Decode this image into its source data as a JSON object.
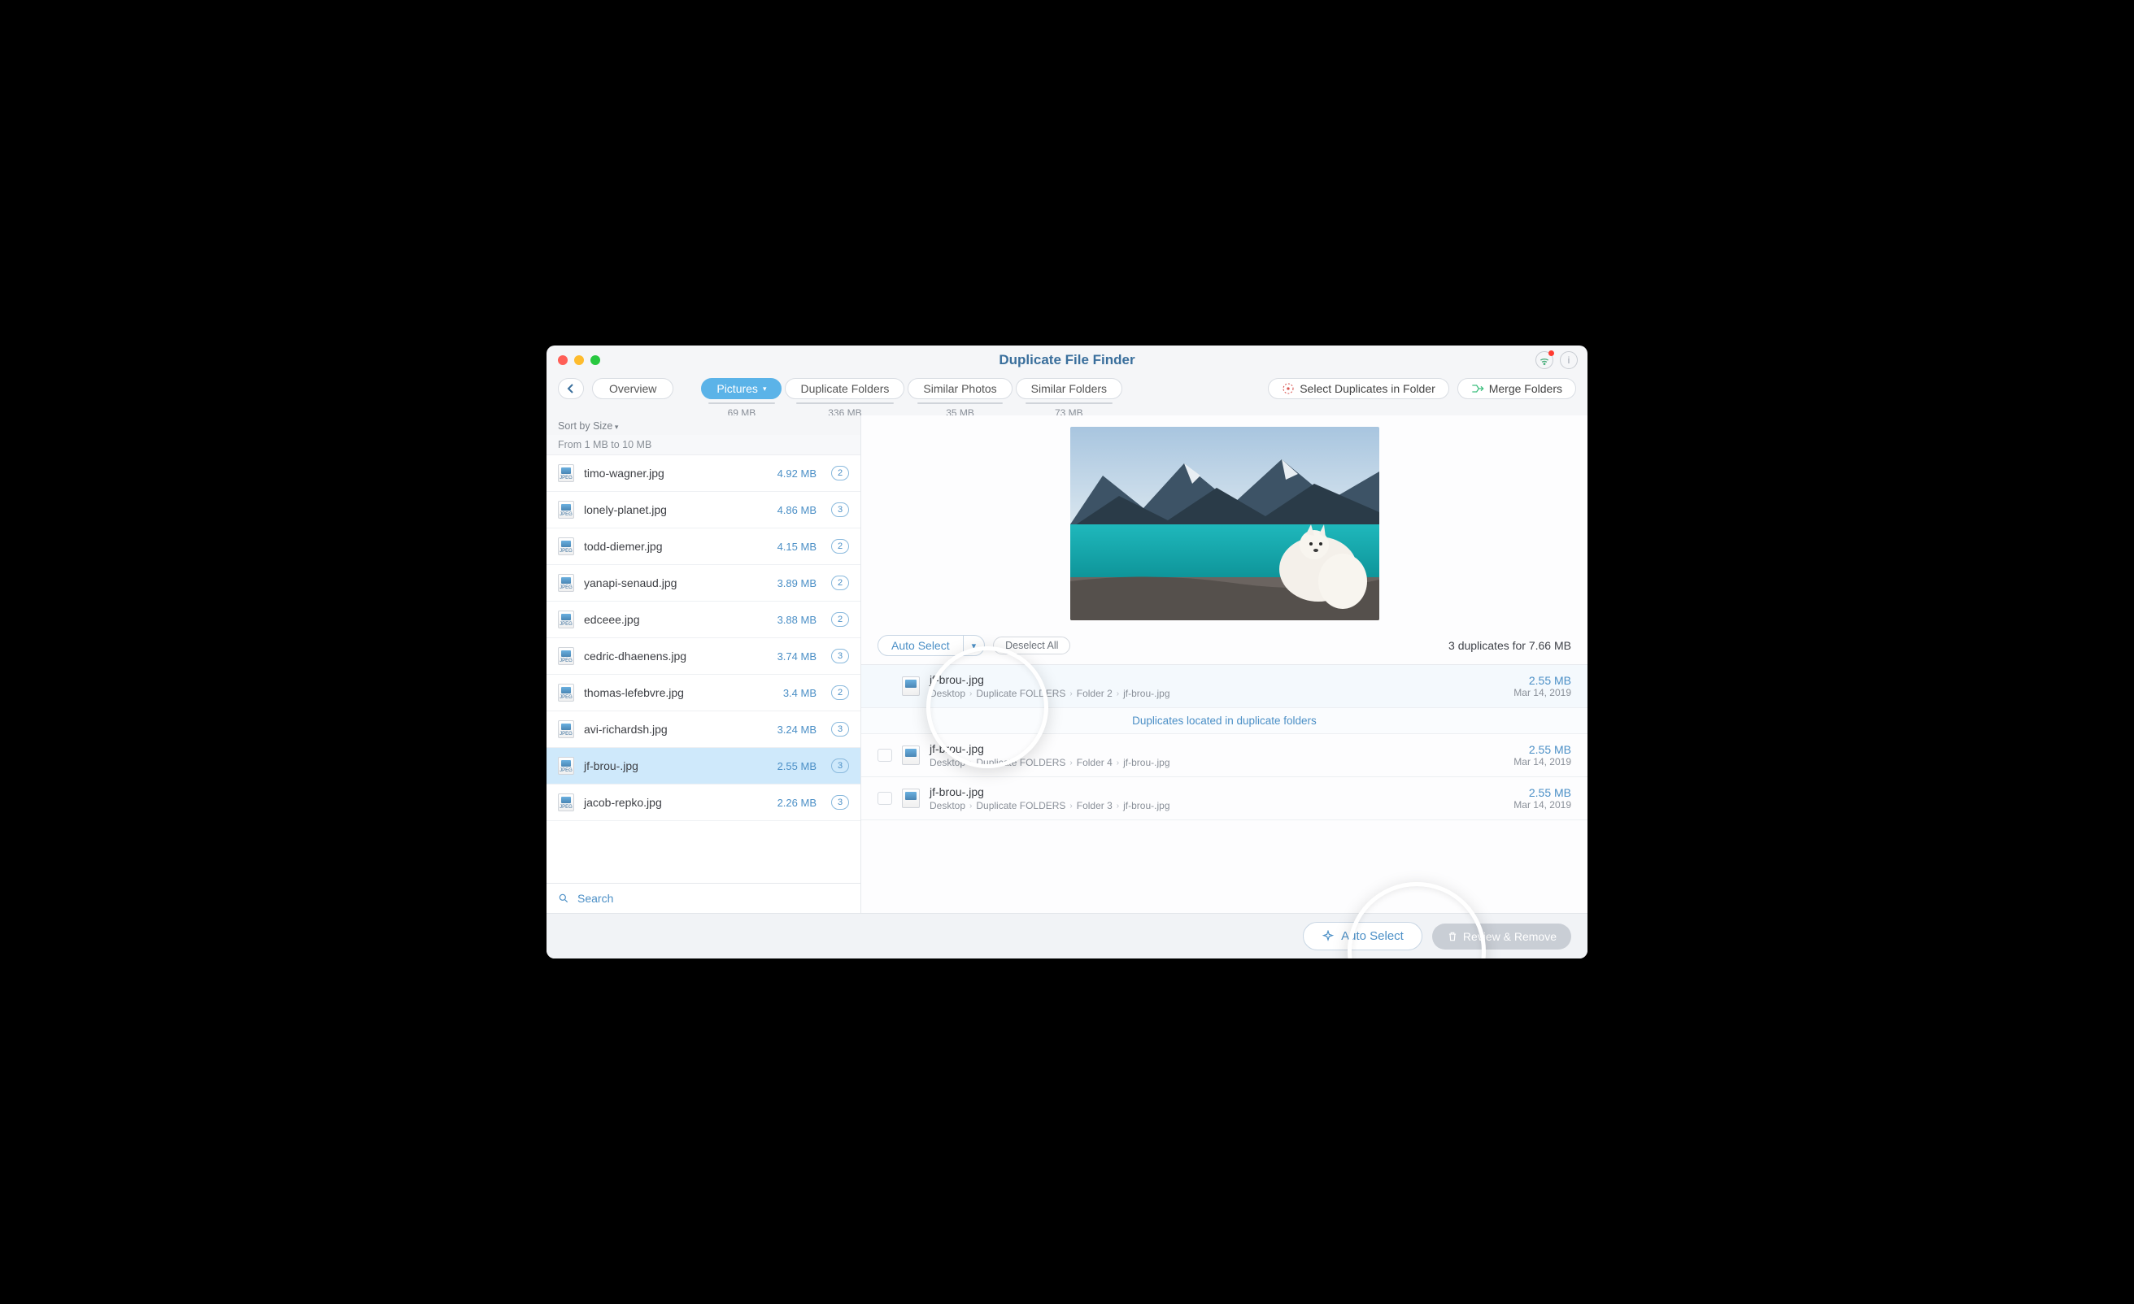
{
  "title": "Duplicate File Finder",
  "toolbar": {
    "overview": "Overview",
    "select_in_folder": "Select Duplicates in Folder",
    "merge_folders": "Merge Folders"
  },
  "tabs": [
    {
      "label": "Pictures",
      "size": "69 MB",
      "active": true,
      "dropdown": true
    },
    {
      "label": "Duplicate Folders",
      "size": "336 MB"
    },
    {
      "label": "Similar Photos",
      "size": "35 MB"
    },
    {
      "label": "Similar Folders",
      "size": "73 MB"
    }
  ],
  "sidebar": {
    "sort_label": "Sort by Size",
    "section_header": "From 1 MB to 10 MB",
    "search_placeholder": "Search",
    "files": [
      {
        "name": "timo-wagner.jpg",
        "size": "4.92 MB",
        "count": "2"
      },
      {
        "name": "lonely-planet.jpg",
        "size": "4.86 MB",
        "count": "3"
      },
      {
        "name": "todd-diemer.jpg",
        "size": "4.15 MB",
        "count": "2"
      },
      {
        "name": "yanapi-senaud.jpg",
        "size": "3.89 MB",
        "count": "2"
      },
      {
        "name": "edceee.jpg",
        "size": "3.88 MB",
        "count": "2"
      },
      {
        "name": "cedric-dhaenens.jpg",
        "size": "3.74 MB",
        "count": "3"
      },
      {
        "name": "thomas-lefebvre.jpg",
        "size": "3.4 MB",
        "count": "2"
      },
      {
        "name": "avi-richardsh.jpg",
        "size": "3.24 MB",
        "count": "3"
      },
      {
        "name": "jf-brou-.jpg",
        "size": "2.55 MB",
        "count": "3",
        "selected": true
      },
      {
        "name": "jacob-repko.jpg",
        "size": "2.26 MB",
        "count": "3"
      }
    ]
  },
  "detail": {
    "auto_select": "Auto Select",
    "deselect_all": "Deselect All",
    "summary": "3 duplicates for 7.66 MB",
    "banner": "Duplicates located in duplicate folders",
    "duplicates": [
      {
        "name": "jf-brou-.jpg",
        "path": [
          "Desktop",
          "Duplicate FOLDERS",
          "Folder 2",
          "jf-brou-.jpg"
        ],
        "size": "2.55 MB",
        "date": "Mar 14, 2019",
        "primary": true
      },
      {
        "name": "jf-brou-.jpg",
        "path": [
          "Desktop",
          "Duplicate FOLDERS",
          "Folder 4",
          "jf-brou-.jpg"
        ],
        "size": "2.55 MB",
        "date": "Mar 14, 2019"
      },
      {
        "name": "jf-brou-.jpg",
        "path": [
          "Desktop",
          "Duplicate FOLDERS",
          "Folder 3",
          "jf-brou-.jpg"
        ],
        "size": "2.55 MB",
        "date": "Mar 14, 2019"
      }
    ]
  },
  "footer": {
    "auto_select": "Auto Select",
    "review_remove": "Review & Remove"
  }
}
